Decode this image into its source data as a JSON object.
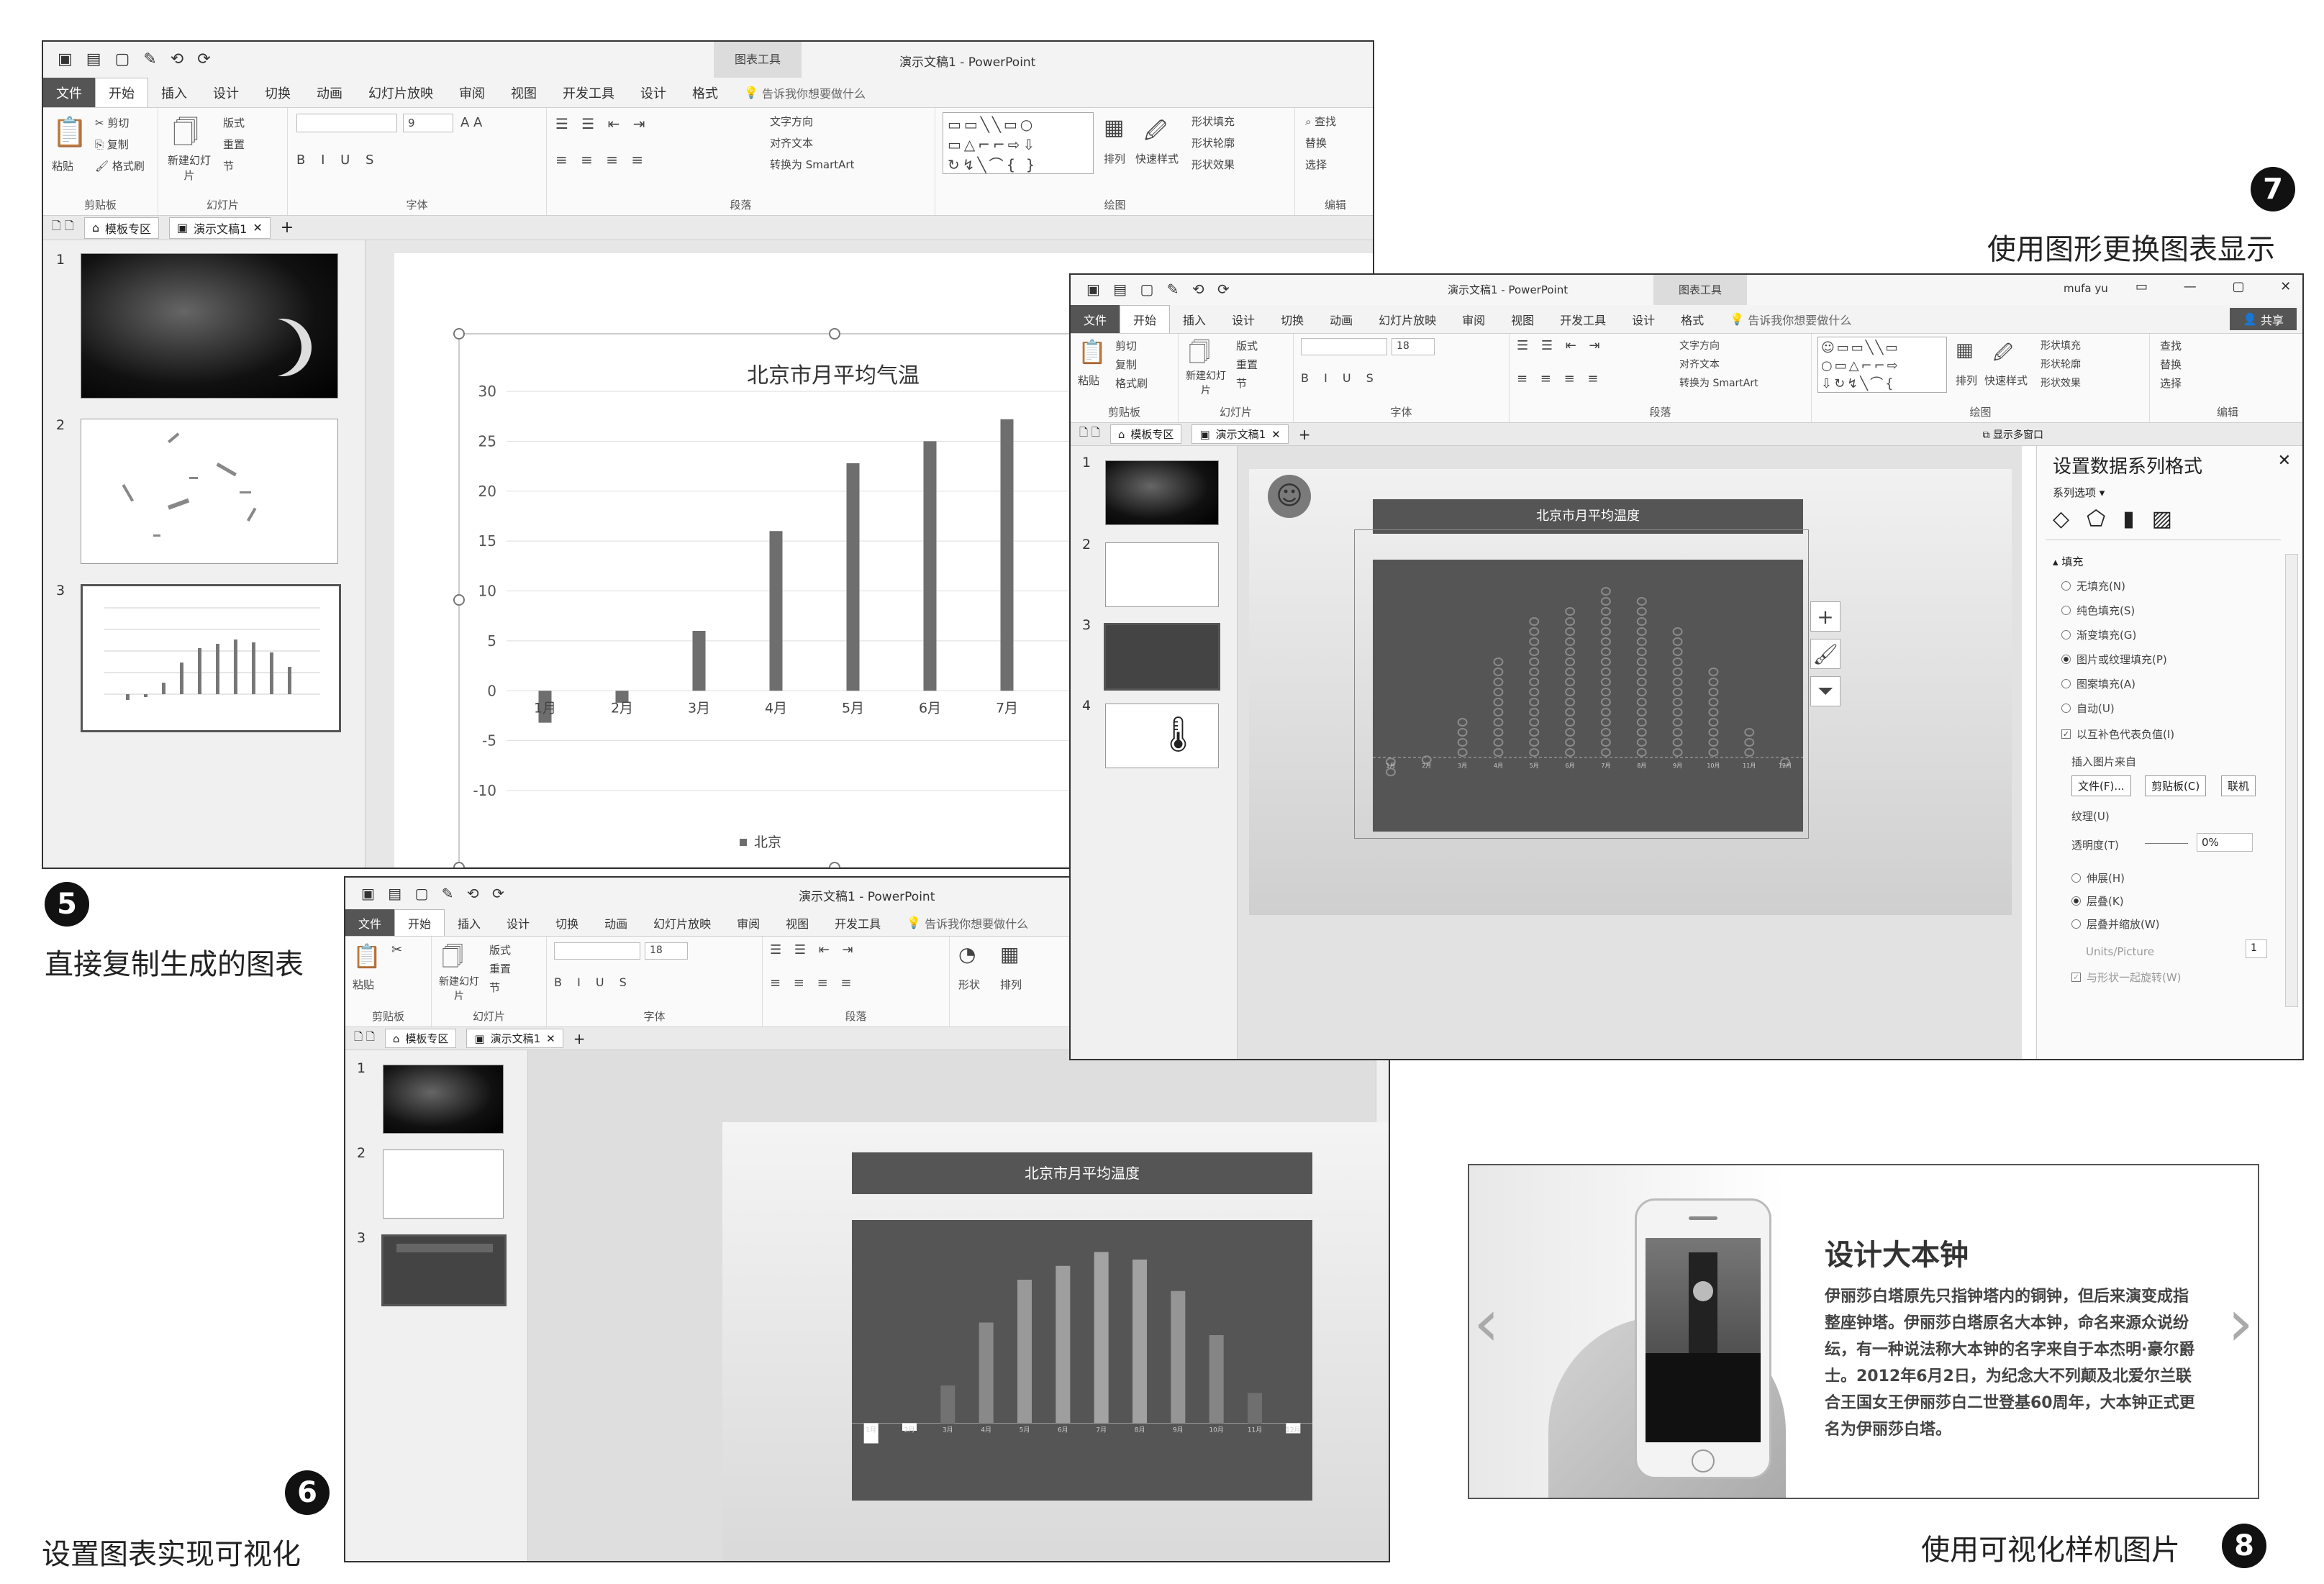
{
  "captions": {
    "c5": {
      "num": "5",
      "text": "直接复制生成的图表"
    },
    "c6": {
      "num": "6",
      "text": "设置图表实现可视化"
    },
    "c7": {
      "num": "7",
      "text": "使用图形更换图表显示"
    },
    "c8": {
      "num": "8",
      "text": "使用可视化样机图片"
    }
  },
  "ribbon_common": {
    "tab_file": "文件",
    "tab_home": "开始",
    "tab_insert": "插入",
    "tab_design": "设计",
    "tab_transition": "切换",
    "tab_animation": "动画",
    "tab_slideshow": "幻灯片放映",
    "tab_review": "审阅",
    "tab_view": "视图",
    "tab_dev": "开发工具",
    "tab_design2": "设计",
    "tab_format": "格式",
    "tell_me": "告诉我你想要做什么",
    "chart_tools": "图表工具",
    "app_title": "演示文稿1 - PowerPoint",
    "paste": "粘贴",
    "cut": "剪切",
    "copy": "复制",
    "format_painter": "格式刷",
    "clipboard": "剪贴板",
    "new_slide": "新建幻灯片",
    "layout": "版式",
    "reset": "重置",
    "section": "节",
    "slides": "幻灯片",
    "font_group": "字体",
    "font_size": "9",
    "font_size_b": "18",
    "paragraph": "段落",
    "text_dir": "文字方向",
    "align_text": "对齐文本",
    "smartart": "转换为 SmartArt",
    "arrange": "排列",
    "quick_styles": "快速样式",
    "shape_fill": "形状填充",
    "shape_outline": "形状轮廓",
    "shape_effects": "形状效果",
    "drawing": "绘图",
    "find": "查找",
    "replace": "替换",
    "select": "选择",
    "editing": "编辑",
    "shapes": "形状",
    "template_area": "模板专区",
    "doc_tab": "演示文稿1",
    "user": "mufa yu",
    "share": "共享",
    "show_multi": "显示多窗口"
  },
  "win5": {
    "chart": {
      "title": "北京市月平均气温",
      "legend": "北京"
    }
  },
  "win6": {
    "slide_title": "北京市月平均温度"
  },
  "win7": {
    "slide_title": "北京市月平均温度",
    "pane": {
      "title": "设置数据系列格式",
      "series_options": "系列选项",
      "fill_header": "填充",
      "options": [
        "无填充(N)",
        "纯色填充(S)",
        "渐变填充(G)",
        "图片或纹理填充(P)",
        "图案填充(A)",
        "自动(U)"
      ],
      "selected_index": 3,
      "invert_label": "以互补色代表负值(I)",
      "insert_from": "插入图片来自",
      "btn_file": "文件(F)...",
      "btn_clipboard": "剪贴板(C)",
      "btn_online": "联机",
      "texture": "纹理(U)",
      "transparency": "透明度(T)",
      "transparency_value": "0%",
      "stretch": "伸展(H)",
      "stack": "层叠(K)",
      "stack_scale": "层叠并缩放(W)",
      "units_picture": "Units/Picture",
      "units_value": "1",
      "rotate_with": "与形状一起旋转(W)"
    }
  },
  "card8": {
    "title": "设计大本钟",
    "body": "伊丽莎白塔原先只指钟塔内的铜钟，但后来演变成指整座钟塔。伊丽莎白塔原名大本钟，命名来源众说纷纭，有一种说法称大本钟的名字来自于本杰明·豪尔爵士。2012年6月2日，为纪念大不列颠及北爱尔兰联合王国女王伊丽莎白二世登基60周年，大本钟正式更名为伊丽莎白塔。",
    "prev": "‹",
    "next": "›"
  },
  "chart_data": [
    {
      "type": "bar",
      "title": "北京市月平均气温",
      "categories": [
        "1月",
        "2月",
        "3月",
        "4月",
        "5月",
        "6月",
        "7月",
        "8月",
        "9月",
        "10月",
        "11月",
        "12月"
      ],
      "series": [
        {
          "name": "北京",
          "values": [
            -3.2,
            -1.2,
            6,
            16,
            22.8,
            25,
            27.2,
            26,
            21,
            14,
            4.8,
            -1.6
          ]
        }
      ],
      "ylim": [
        -10,
        30
      ],
      "yticks": [
        -10,
        -5,
        0,
        5,
        10,
        15,
        20,
        25,
        30
      ],
      "grid": true,
      "legend": "bottom"
    }
  ]
}
